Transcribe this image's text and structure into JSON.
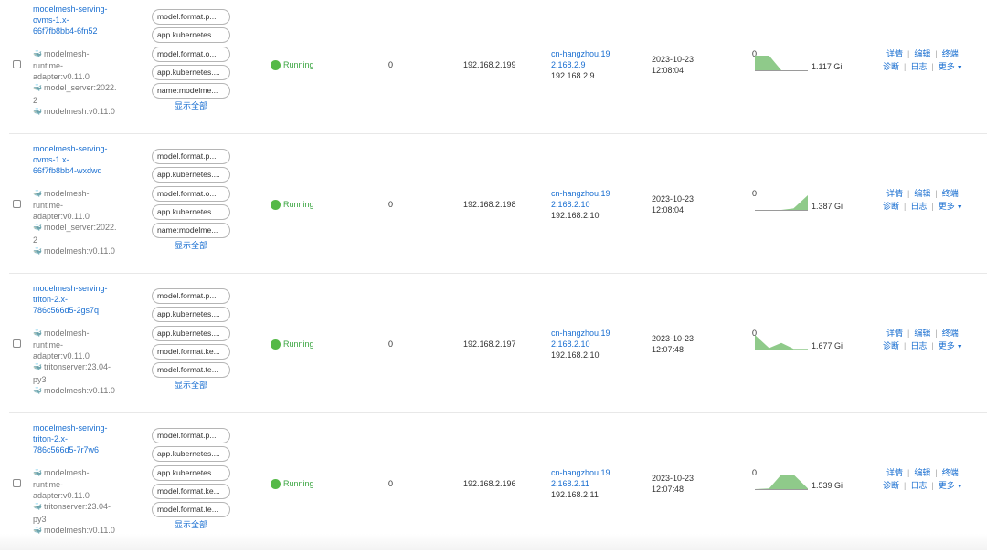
{
  "ui": {
    "show_all": "显示全部",
    "actions": {
      "details": "详情",
      "edit": "编辑",
      "terminal": "终端",
      "diagnose": "诊断",
      "logs": "日志",
      "more": "更多",
      "separator": "|"
    },
    "colors": {
      "link": "#1a6fd1",
      "running": "#3aa540",
      "chart_fill": "#8fca8a"
    }
  },
  "pods": [
    {
      "name": [
        "modelmesh-serving-",
        "ovms-1.x-",
        "66f7fb8bb4-6fn52"
      ],
      "containers": [
        {
          "icon": "docker-icon",
          "image": [
            "modelmesh-",
            "runtime-",
            "adapter:v0.11.0"
          ]
        },
        {
          "icon": "docker-icon",
          "image": [
            "model_server:2022.",
            "2"
          ]
        },
        {
          "icon": "docker-icon",
          "image": [
            "modelmesh:v0.11.0"
          ]
        }
      ],
      "labels": [
        "model.format.p...",
        "app.kubernetes....",
        "model.format.o...",
        "app.kubernetes....",
        "name:modelme..."
      ],
      "status": "Running",
      "restarts": "0",
      "pod_ip": "192.168.2.199",
      "node_name": [
        "cn-hangzhou.19",
        "2.168.2.9"
      ],
      "node_ip": "192.168.2.9",
      "created_date": "2023-10-23",
      "created_time": "12:08:04",
      "memory": {
        "min_label": "0",
        "value": "1.117 Gi",
        "trend": [
          1,
          1,
          0,
          0,
          0
        ]
      }
    },
    {
      "name": [
        "modelmesh-serving-",
        "ovms-1.x-",
        "66f7fb8bb4-wxdwq"
      ],
      "containers": [
        {
          "icon": "docker-icon",
          "image": [
            "modelmesh-",
            "runtime-",
            "adapter:v0.11.0"
          ]
        },
        {
          "icon": "docker-icon",
          "image": [
            "model_server:2022.",
            "2"
          ]
        },
        {
          "icon": "docker-icon",
          "image": [
            "modelmesh:v0.11.0"
          ]
        }
      ],
      "labels": [
        "model.format.p...",
        "app.kubernetes....",
        "model.format.o...",
        "app.kubernetes....",
        "name:modelme..."
      ],
      "status": "Running",
      "restarts": "0",
      "pod_ip": "192.168.2.198",
      "node_name": [
        "cn-hangzhou.19",
        "2.168.2.10"
      ],
      "node_ip": "192.168.2.10",
      "created_date": "2023-10-23",
      "created_time": "12:08:04",
      "memory": {
        "min_label": "0",
        "value": "1.387 Gi",
        "trend": [
          0,
          0,
          0,
          0.1,
          1
        ]
      }
    },
    {
      "name": [
        "modelmesh-serving-",
        "triton-2.x-",
        "786c566d5-2gs7q"
      ],
      "containers": [
        {
          "icon": "docker-icon",
          "image": [
            "modelmesh-",
            "runtime-",
            "adapter:v0.11.0"
          ]
        },
        {
          "icon": "docker-icon",
          "image": [
            "tritonserver:23.04-",
            "py3"
          ]
        },
        {
          "icon": "docker-icon",
          "image": [
            "modelmesh:v0.11.0"
          ]
        }
      ],
      "labels": [
        "model.format.p...",
        "app.kubernetes....",
        "app.kubernetes....",
        "model.format.ke...",
        "model.format.te..."
      ],
      "status": "Running",
      "restarts": "0",
      "pod_ip": "192.168.2.197",
      "node_name": [
        "cn-hangzhou.19",
        "2.168.2.10"
      ],
      "node_ip": "192.168.2.10",
      "created_date": "2023-10-23",
      "created_time": "12:07:48",
      "memory": {
        "min_label": "0",
        "value": "1.677 Gi",
        "trend": [
          1,
          0.1,
          0.45,
          0.05,
          0.05
        ]
      }
    },
    {
      "name": [
        "modelmesh-serving-",
        "triton-2.x-",
        "786c566d5-7r7w6"
      ],
      "containers": [
        {
          "icon": "docker-icon",
          "image": [
            "modelmesh-",
            "runtime-",
            "adapter:v0.11.0"
          ]
        },
        {
          "icon": "docker-icon",
          "image": [
            "tritonserver:23.04-",
            "py3"
          ]
        },
        {
          "icon": "docker-icon",
          "image": [
            "modelmesh:v0.11.0"
          ]
        }
      ],
      "labels": [
        "model.format.p...",
        "app.kubernetes....",
        "app.kubernetes....",
        "model.format.ke...",
        "model.format.te..."
      ],
      "status": "Running",
      "restarts": "0",
      "pod_ip": "192.168.2.196",
      "node_name": [
        "cn-hangzhou.19",
        "2.168.2.11"
      ],
      "node_ip": "192.168.2.11",
      "created_date": "2023-10-23",
      "created_time": "12:07:48",
      "memory": {
        "min_label": "0",
        "value": "1.539 Gi",
        "trend": [
          0,
          0.05,
          1,
          1,
          0.05
        ]
      }
    }
  ]
}
